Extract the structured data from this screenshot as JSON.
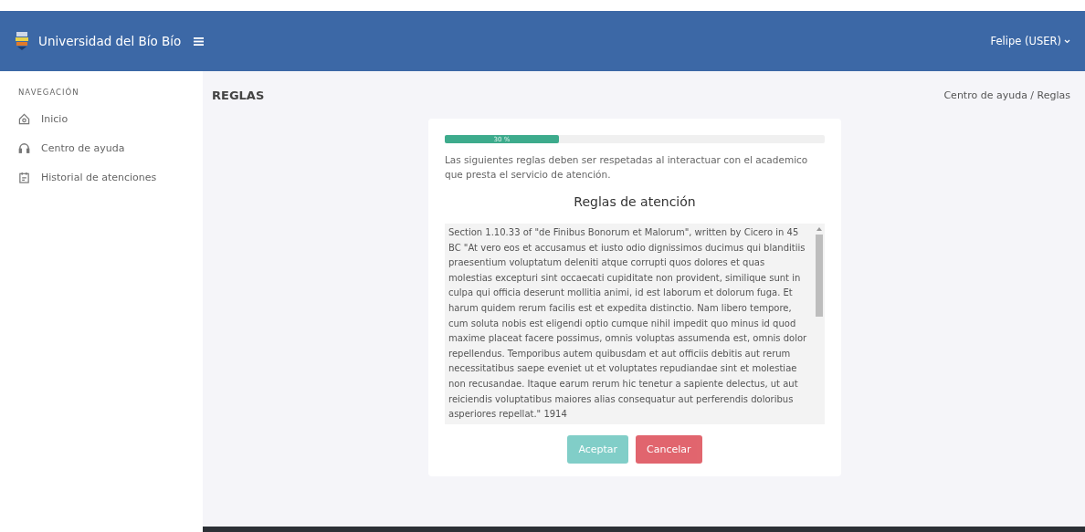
{
  "header": {
    "brand": "Universidad del Bío Bío",
    "user": "Felipe (USER)"
  },
  "sidebar": {
    "heading": "NAVEGACIÓN",
    "items": [
      {
        "label": "Inicio",
        "kind": "home"
      },
      {
        "label": "Centro de ayuda",
        "kind": "headset"
      },
      {
        "label": "Historial de atenciones",
        "kind": "calendar"
      }
    ]
  },
  "page": {
    "title": "REGLAS",
    "breadcrumb": "Centro de ayuda / Reglas"
  },
  "card": {
    "progress": {
      "level": 0.3,
      "label": "30 %"
    },
    "intro": "Las siguientes reglas deben ser respetadas al interactuar con el academico que presta el servicio de atención.",
    "heading": "Reglas de atención",
    "rules_text": "Section 1.10.33 of \"de Finibus Bonorum et Malorum\", written by Cicero in 45 BC \"At vero eos et accusamus et iusto odio dignissimos ducimus qui blanditiis praesentium voluptatum deleniti atque corrupti quos dolores et quas molestias excepturi sint occaecati cupiditate non provident, similique sunt in culpa qui officia deserunt mollitia animi, id est laborum et dolorum fuga. Et harum quidem rerum facilis est et expedita distinctio. Nam libero tempore, cum soluta nobis est eligendi optio cumque nihil impedit quo minus id quod maxime placeat facere possimus, omnis voluptas assumenda est, omnis dolor repellendus. Temporibus autem quibusdam et aut officiis debitis aut rerum necessitatibus saepe eveniet ut et voluptates repudiandae sint et molestiae non recusandae. Itaque earum rerum hic tenetur a sapiente delectus, ut aut reiciendis voluptatibus maiores alias consequatur aut perferendis doloribus asperiores repellat.\" 1914",
    "buttons": [
      {
        "label": "Aceptar",
        "kind": "accept",
        "disabled": true
      },
      {
        "label": "Cancelar",
        "kind": "cancel",
        "disabled": false
      }
    ]
  }
}
